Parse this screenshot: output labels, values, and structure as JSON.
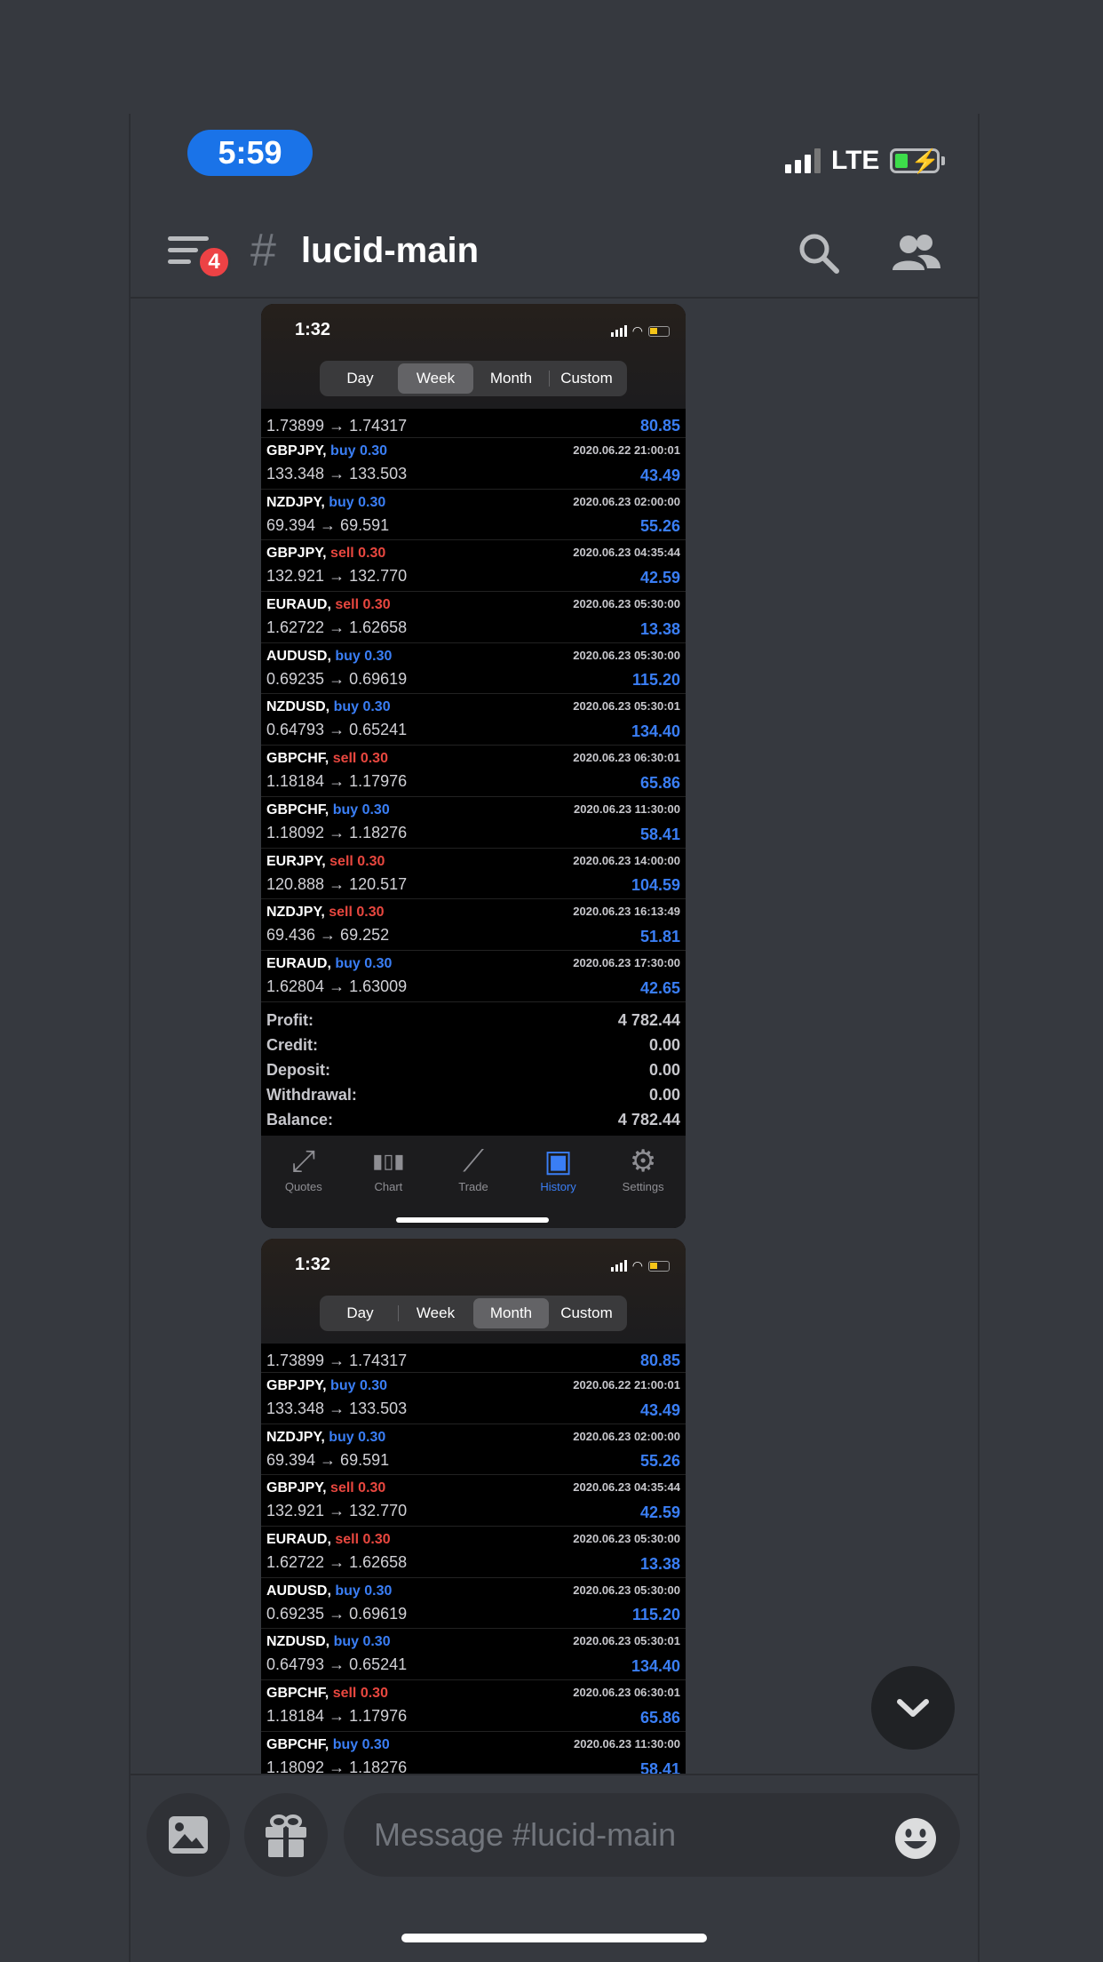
{
  "status_bar": {
    "time": "5:59",
    "network": "LTE"
  },
  "header": {
    "menu_badge": "4",
    "hash": "#",
    "channel": "lucid-main"
  },
  "shots": [
    {
      "time": "1:32",
      "segments": [
        "Day",
        "Week",
        "Month",
        "Custom"
      ],
      "active_segment": "Week",
      "first_row": {
        "prices": "1.73899 → 1.74317",
        "profit": "80.85"
      },
      "rows": [
        {
          "symbol": "GBPJPY,",
          "side": "buy 0.30",
          "type": "buy",
          "date": "2020.06.22 21:00:01",
          "prices": "133.348 → 133.503",
          "profit": "43.49"
        },
        {
          "symbol": "NZDJPY,",
          "side": "buy 0.30",
          "type": "buy",
          "date": "2020.06.23 02:00:00",
          "prices": "69.394 → 69.591",
          "profit": "55.26"
        },
        {
          "symbol": "GBPJPY,",
          "side": "sell 0.30",
          "type": "sell",
          "date": "2020.06.23 04:35:44",
          "prices": "132.921 → 132.770",
          "profit": "42.59"
        },
        {
          "symbol": "EURAUD,",
          "side": "sell 0.30",
          "type": "sell",
          "date": "2020.06.23 05:30:00",
          "prices": "1.62722 → 1.62658",
          "profit": "13.38"
        },
        {
          "symbol": "AUDUSD,",
          "side": "buy 0.30",
          "type": "buy",
          "date": "2020.06.23 05:30:00",
          "prices": "0.69235 → 0.69619",
          "profit": "115.20"
        },
        {
          "symbol": "NZDUSD,",
          "side": "buy 0.30",
          "type": "buy",
          "date": "2020.06.23 05:30:01",
          "prices": "0.64793 → 0.65241",
          "profit": "134.40"
        },
        {
          "symbol": "GBPCHF,",
          "side": "sell 0.30",
          "type": "sell",
          "date": "2020.06.23 06:30:01",
          "prices": "1.18184 → 1.17976",
          "profit": "65.86"
        },
        {
          "symbol": "GBPCHF,",
          "side": "buy 0.30",
          "type": "buy",
          "date": "2020.06.23 11:30:00",
          "prices": "1.18092 → 1.18276",
          "profit": "58.41"
        },
        {
          "symbol": "EURJPY,",
          "side": "sell 0.30",
          "type": "sell",
          "date": "2020.06.23 14:00:00",
          "prices": "120.888 → 120.517",
          "profit": "104.59"
        },
        {
          "symbol": "NZDJPY,",
          "side": "sell 0.30",
          "type": "sell",
          "date": "2020.06.23 16:13:49",
          "prices": "69.436 → 69.252",
          "profit": "51.81"
        },
        {
          "symbol": "EURAUD,",
          "side": "buy 0.30",
          "type": "buy",
          "date": "2020.06.23 17:30:00",
          "prices": "1.62804 → 1.63009",
          "profit": "42.65"
        }
      ],
      "summary": [
        {
          "label": "Profit:",
          "value": "4 782.44"
        },
        {
          "label": "Credit:",
          "value": "0.00"
        },
        {
          "label": "Deposit:",
          "value": "0.00"
        },
        {
          "label": "Withdrawal:",
          "value": "0.00"
        },
        {
          "label": "Balance:",
          "value": "4 782.44"
        }
      ],
      "tabs": [
        {
          "label": "Quotes",
          "icon": "quotes-icon"
        },
        {
          "label": "Chart",
          "icon": "chart-icon"
        },
        {
          "label": "Trade",
          "icon": "trade-icon"
        },
        {
          "label": "History",
          "icon": "history-icon",
          "active": true
        },
        {
          "label": "Settings",
          "icon": "settings-icon"
        }
      ]
    },
    {
      "time": "1:32",
      "segments": [
        "Day",
        "Week",
        "Month",
        "Custom"
      ],
      "active_segment": "Month",
      "first_row": {
        "prices": "1.73899 → 1.74317",
        "profit": "80.85"
      },
      "rows": [
        {
          "symbol": "GBPJPY,",
          "side": "buy 0.30",
          "type": "buy",
          "date": "2020.06.22 21:00:01",
          "prices": "133.348 → 133.503",
          "profit": "43.49"
        },
        {
          "symbol": "NZDJPY,",
          "side": "buy 0.30",
          "type": "buy",
          "date": "2020.06.23 02:00:00",
          "prices": "69.394 → 69.591",
          "profit": "55.26"
        },
        {
          "symbol": "GBPJPY,",
          "side": "sell 0.30",
          "type": "sell",
          "date": "2020.06.23 04:35:44",
          "prices": "132.921 → 132.770",
          "profit": "42.59"
        },
        {
          "symbol": "EURAUD,",
          "side": "sell 0.30",
          "type": "sell",
          "date": "2020.06.23 05:30:00",
          "prices": "1.62722 → 1.62658",
          "profit": "13.38"
        },
        {
          "symbol": "AUDUSD,",
          "side": "buy 0.30",
          "type": "buy",
          "date": "2020.06.23 05:30:00",
          "prices": "0.69235 → 0.69619",
          "profit": "115.20"
        },
        {
          "symbol": "NZDUSD,",
          "side": "buy 0.30",
          "type": "buy",
          "date": "2020.06.23 05:30:01",
          "prices": "0.64793 → 0.65241",
          "profit": "134.40"
        },
        {
          "symbol": "GBPCHF,",
          "side": "sell 0.30",
          "type": "sell",
          "date": "2020.06.23 06:30:01",
          "prices": "1.18184 → 1.17976",
          "profit": "65.86"
        },
        {
          "symbol": "GBPCHF,",
          "side": "buy 0.30",
          "type": "buy",
          "date": "2020.06.23 11:30:00",
          "prices": "1.18092 → 1.18276",
          "profit": "58.41"
        }
      ]
    }
  ],
  "composer": {
    "placeholder": "Message #lucid-main"
  },
  "colors": {
    "background": "#36393f",
    "accent": "#3a7ef5",
    "sell": "#e8473f",
    "badge": "#ed4245",
    "pill": "#1a73e8"
  }
}
